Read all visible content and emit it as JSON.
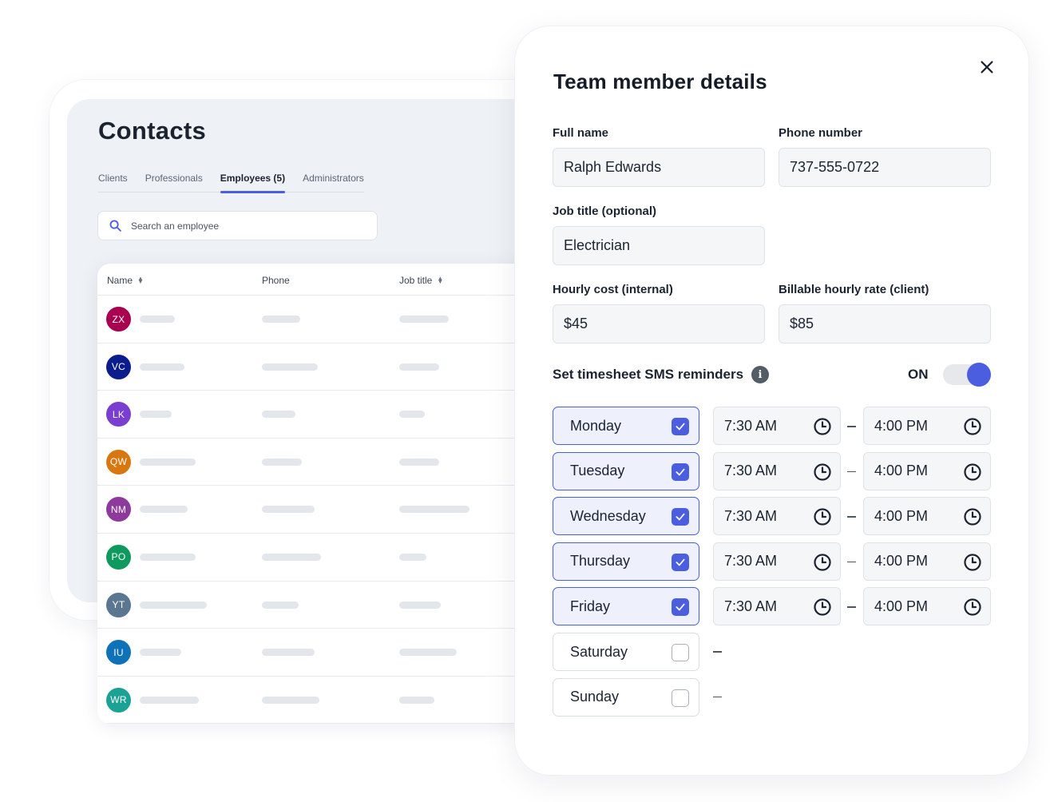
{
  "contacts": {
    "title": "Contacts",
    "tabs": [
      "Clients",
      "Professionals",
      "Employees (5)",
      "Administrators"
    ],
    "active_tab_index": 2,
    "search": {
      "placeholder": "Search an employee",
      "value": ""
    },
    "columns": [
      "Name",
      "Phone",
      "Job title"
    ],
    "rows": [
      {
        "initials": "ZX",
        "color": "#a8004f"
      },
      {
        "initials": "VC",
        "color": "#0b1c8c"
      },
      {
        "initials": "LK",
        "color": "#7a3ed0"
      },
      {
        "initials": "QW",
        "color": "#d8760f"
      },
      {
        "initials": "NM",
        "color": "#8e3a9c"
      },
      {
        "initials": "PO",
        "color": "#0e9a5e"
      },
      {
        "initials": "YT",
        "color": "#5a7691"
      },
      {
        "initials": "IU",
        "color": "#0f72b8"
      },
      {
        "initials": "WR",
        "color": "#1aa394"
      }
    ]
  },
  "modal": {
    "title": "Team member details",
    "full_name_label": "Full name",
    "full_name_value": "Ralph Edwards",
    "phone_label": "Phone number",
    "phone_value": "737-555-0722",
    "job_title_label": "Job title (optional)",
    "job_title_value": "Electrician",
    "hourly_cost_label": "Hourly cost (internal)",
    "hourly_cost_value": "$45",
    "billable_rate_label": "Billable hourly rate (client)",
    "billable_rate_value": "$85",
    "sms_label": "Set timesheet SMS reminders",
    "sms_state_label": "ON",
    "sms_enabled": true,
    "days": [
      {
        "name": "Monday",
        "checked": true,
        "start": "7:30 AM",
        "end": "4:00 PM"
      },
      {
        "name": "Tuesday",
        "checked": true,
        "start": "7:30 AM",
        "end": "4:00 PM"
      },
      {
        "name": "Wednesday",
        "checked": true,
        "start": "7:30 AM",
        "end": "4:00 PM"
      },
      {
        "name": "Thursday",
        "checked": true,
        "start": "7:30 AM",
        "end": "4:00 PM"
      },
      {
        "name": "Friday",
        "checked": true,
        "start": "7:30 AM",
        "end": "4:00 PM"
      },
      {
        "name": "Saturday",
        "checked": false,
        "start": "",
        "end": ""
      },
      {
        "name": "Sunday",
        "checked": false,
        "start": "",
        "end": ""
      }
    ]
  },
  "colors": {
    "accent": "#4c5ee0",
    "field_bg": "#f4f6f8",
    "page_bg": "#eef1f5"
  },
  "icons": [
    "search-icon",
    "close-icon",
    "info-icon",
    "clock-icon",
    "check-icon",
    "sort-icon"
  ]
}
